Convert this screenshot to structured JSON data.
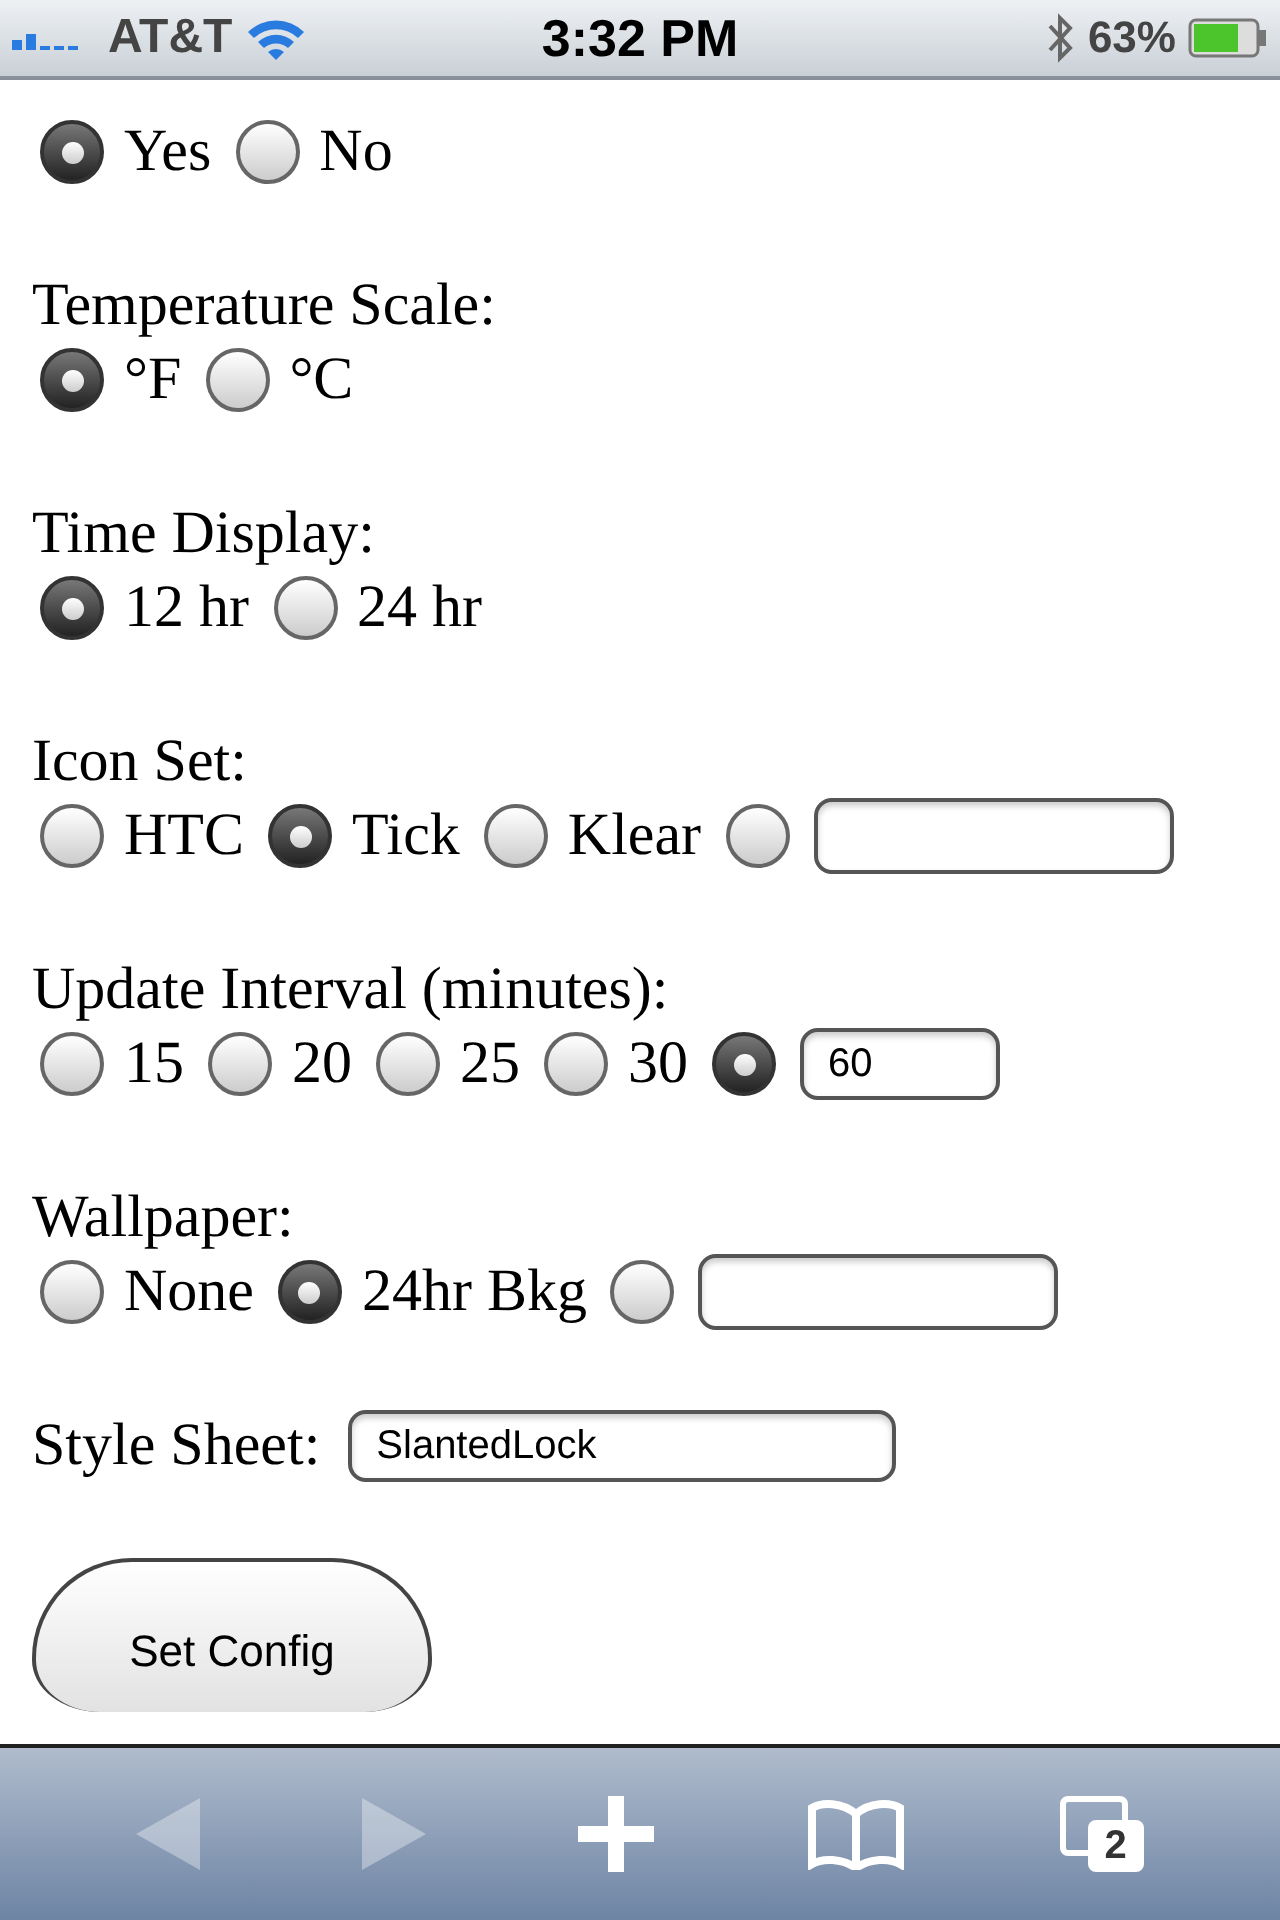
{
  "status_bar": {
    "carrier": "AT&T",
    "time": "3:32 PM",
    "battery": "63%"
  },
  "sections": [
    {
      "kind": "radios",
      "options": [
        {
          "kind": "text",
          "label": "Yes",
          "selected": true
        },
        {
          "kind": "text",
          "label": "No",
          "selected": false
        }
      ]
    },
    {
      "kind": "radios",
      "label": "Temperature Scale:",
      "options": [
        {
          "kind": "text",
          "label": "°F",
          "selected": true
        },
        {
          "kind": "text",
          "label": "°C",
          "selected": false
        }
      ]
    },
    {
      "kind": "radios",
      "label": "Time Display:",
      "options": [
        {
          "kind": "text",
          "label": "12 hr",
          "selected": true
        },
        {
          "kind": "text",
          "label": "24 hr",
          "selected": false
        }
      ]
    },
    {
      "kind": "radios",
      "label": "Icon Set:",
      "options": [
        {
          "kind": "text",
          "label": "HTC",
          "selected": false
        },
        {
          "kind": "text",
          "label": "Tick",
          "selected": true
        },
        {
          "kind": "text",
          "label": "Klear",
          "selected": false
        },
        {
          "kind": "field",
          "selected": false
        }
      ]
    },
    {
      "kind": "radios",
      "label": "Update Interval (minutes):",
      "options": [
        {
          "kind": "text",
          "label": "15",
          "selected": false
        },
        {
          "kind": "text",
          "label": "20",
          "selected": false
        },
        {
          "kind": "text",
          "label": "25",
          "selected": false
        },
        {
          "kind": "text",
          "label": "30",
          "selected": false
        },
        {
          "kind": "short-field",
          "value": "60",
          "selected": true
        }
      ]
    },
    {
      "kind": "radios",
      "label": "Wallpaper:",
      "options": [
        {
          "kind": "text",
          "label": "None",
          "selected": false
        },
        {
          "kind": "text",
          "label": "24hr Bkg",
          "selected": true
        },
        {
          "kind": "field",
          "selected": false
        }
      ]
    },
    {
      "kind": "inline-field",
      "label": "Style Sheet:",
      "value": "SlantedLock"
    }
  ],
  "submit": "Set Config",
  "toolbar": [
    {
      "kind": "back",
      "disabled": true
    },
    {
      "kind": "forward",
      "disabled": true
    },
    {
      "kind": "add",
      "disabled": false
    },
    {
      "kind": "bookmarks",
      "disabled": false
    },
    {
      "kind": "tabs",
      "disabled": false,
      "count": "2"
    }
  ]
}
